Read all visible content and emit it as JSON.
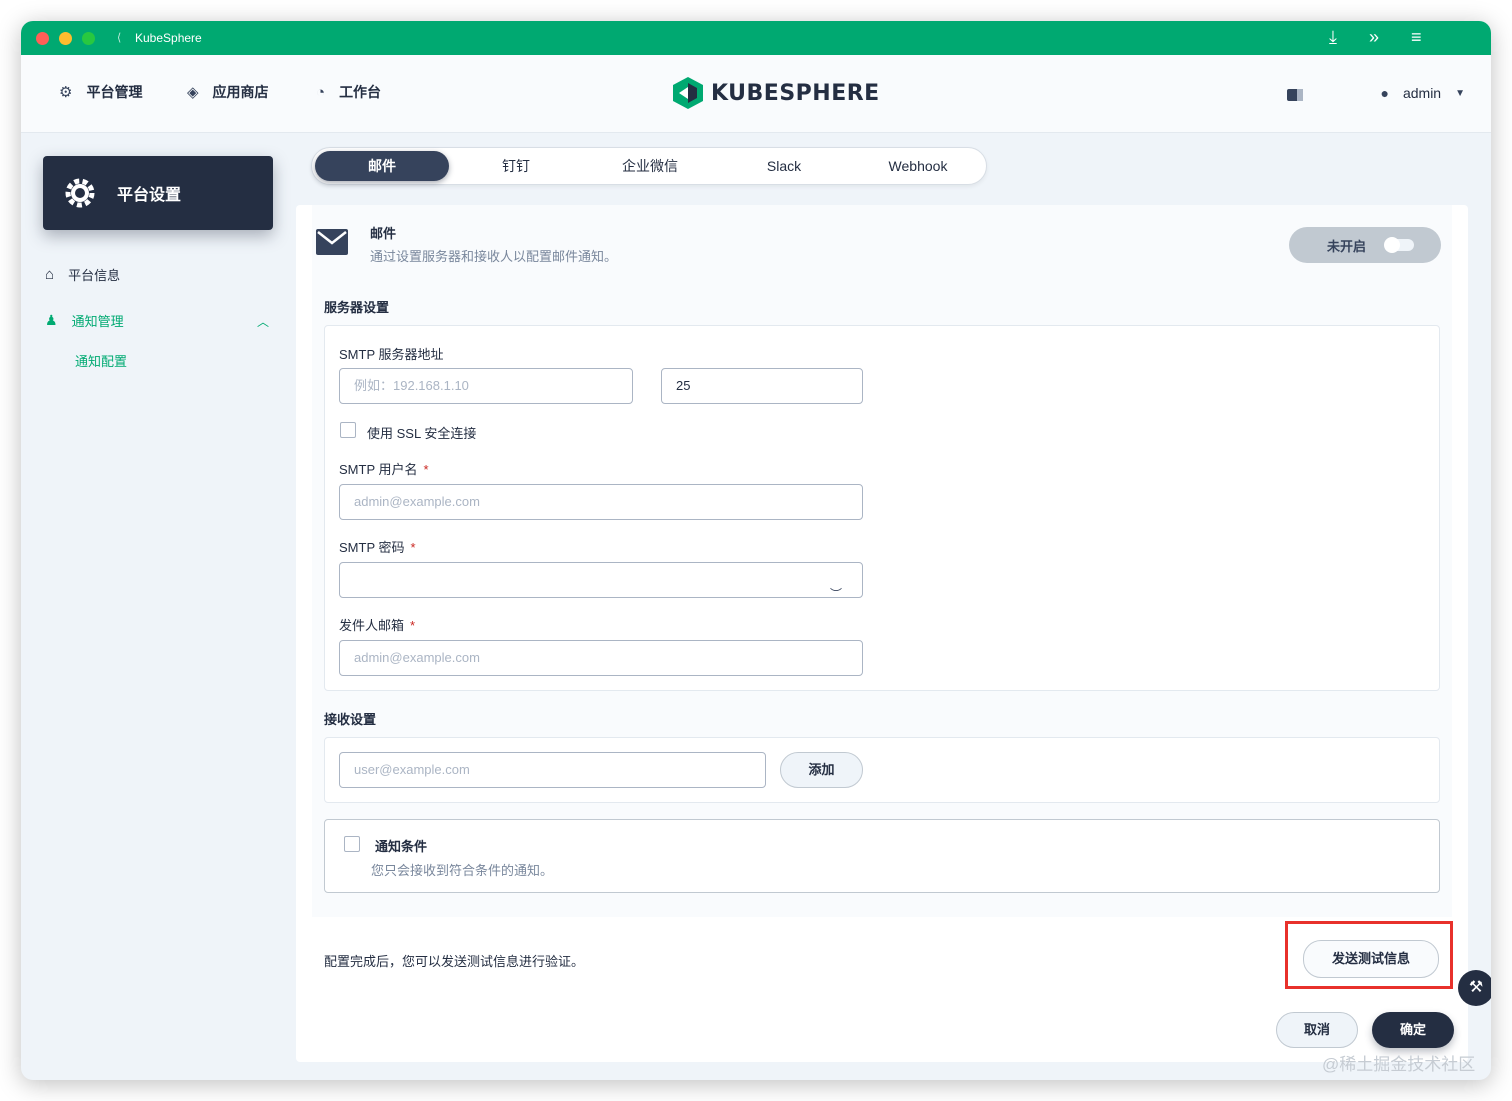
{
  "window": {
    "app_title": "KubeSphere"
  },
  "topnav": {
    "items": [
      {
        "label": "平台管理",
        "icon": "gear-icon"
      },
      {
        "label": "应用商店",
        "icon": "layers-icon"
      },
      {
        "label": "工作台",
        "icon": "dashboard-icon"
      }
    ],
    "logo_text": "KUBESPHERE",
    "user": "admin"
  },
  "sidebar": {
    "card_title": "平台设置",
    "items": [
      {
        "label": "平台信息"
      },
      {
        "label": "通知管理"
      }
    ],
    "sub_item": "通知配置"
  },
  "tabs": [
    "邮件",
    "钉钉",
    "企业微信",
    "Slack",
    "Webhook"
  ],
  "mail": {
    "title": "邮件",
    "description": "通过设置服务器和接收人以配置邮件通知。",
    "toggle_label": "未开启"
  },
  "server": {
    "group_label": "服务器设置",
    "smtp_address_label": "SMTP 服务器地址",
    "smtp_address_placeholder": "例如：192.168.1.10",
    "port_value": "25",
    "ssl_label": "使用 SSL 安全连接",
    "username_label": "SMTP 用户名",
    "username_placeholder": "admin@example.com",
    "password_label": "SMTP 密码",
    "sender_label": "发件人邮箱",
    "sender_placeholder": "admin@example.com",
    "required_mark": "*"
  },
  "receiver": {
    "group_label": "接收设置",
    "email_placeholder": "user@example.com",
    "add_label": "添加"
  },
  "condition": {
    "title": "通知条件",
    "description": "您只会接收到符合条件的通知。"
  },
  "footer": {
    "hint": "配置完成后，您可以发送测试信息进行验证。",
    "send_test_label": "发送测试信息",
    "cancel_label": "取消",
    "confirm_label": "确定"
  },
  "watermark": "@稀土掘金技术社区",
  "colors": {
    "brand_green": "#00a971",
    "dark": "#242e42",
    "highlight_red": "#e8312b"
  }
}
